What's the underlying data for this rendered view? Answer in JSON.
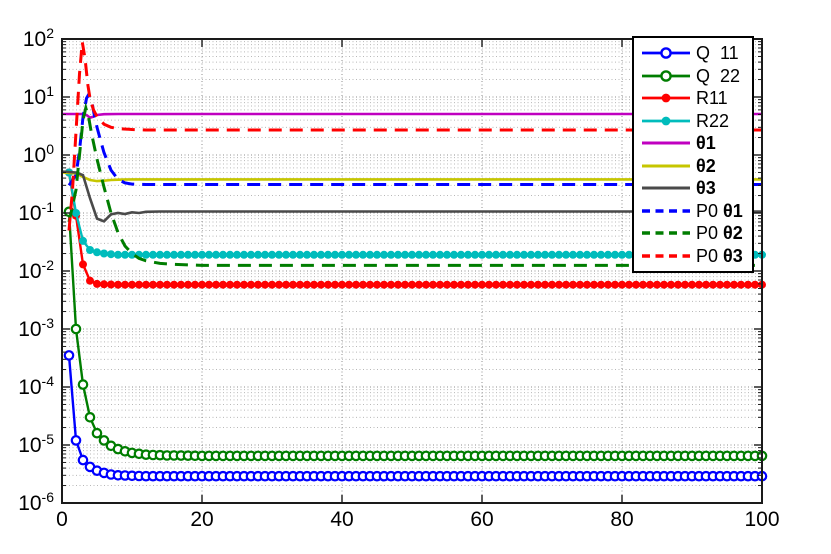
{
  "chart_data": {
    "type": "line",
    "title": "",
    "xlabel": "",
    "ylabel": "",
    "xlim": [
      0,
      100
    ],
    "ylim_log10": [
      -6,
      2
    ],
    "x_ticks": [
      0,
      20,
      40,
      60,
      80,
      100
    ],
    "y_tick_exponents": [
      2,
      1,
      0,
      -1,
      -2,
      -3,
      -4,
      -5,
      -6
    ],
    "grid": "dotted major + log-minor horizontal lines, dotted vertical at x ticks",
    "legend_position": "top-right",
    "series": [
      {
        "name": "Q11",
        "legend_pre": "Q  11",
        "legend_bold": "",
        "color": "#0000ff",
        "line": "solid",
        "marker": "open-circle",
        "width": 2.4,
        "points": [
          [
            1,
            0.00035
          ],
          [
            2,
            1.2e-05
          ],
          [
            3,
            5.5e-06
          ],
          [
            4,
            4.2e-06
          ],
          [
            5,
            3.6e-06
          ],
          [
            6,
            3.3e-06
          ],
          [
            7,
            3.1e-06
          ],
          [
            8,
            3e-06
          ],
          [
            10,
            2.95e-06
          ],
          [
            12,
            2.9e-06
          ],
          [
            100,
            2.9e-06
          ]
        ]
      },
      {
        "name": "Q22",
        "legend_pre": "Q  22",
        "legend_bold": "",
        "color": "#007d00",
        "line": "solid",
        "marker": "open-circle",
        "width": 2.4,
        "points": [
          [
            1,
            0.105
          ],
          [
            2,
            0.001
          ],
          [
            3,
            0.00011
          ],
          [
            4,
            3e-05
          ],
          [
            5,
            1.6e-05
          ],
          [
            6,
            1.2e-05
          ],
          [
            7,
            9.7e-06
          ],
          [
            8,
            8.5e-06
          ],
          [
            9,
            7.8e-06
          ],
          [
            10,
            7.3e-06
          ],
          [
            12,
            6.8e-06
          ],
          [
            15,
            6.6e-06
          ],
          [
            20,
            6.5e-06
          ],
          [
            100,
            6.5e-06
          ]
        ]
      },
      {
        "name": "R11",
        "legend_pre": "R11",
        "legend_bold": "",
        "color": "#ff0000",
        "line": "solid",
        "marker": "filled-circle",
        "width": 2.4,
        "points": [
          [
            1,
            0.5
          ],
          [
            2,
            0.09
          ],
          [
            3,
            0.013
          ],
          [
            4,
            0.0068
          ],
          [
            5,
            0.006
          ],
          [
            6,
            0.0059
          ],
          [
            8,
            0.0058
          ],
          [
            100,
            0.0058
          ]
        ]
      },
      {
        "name": "R22",
        "legend_pre": "R22",
        "legend_bold": "",
        "color": "#00bcbc",
        "line": "solid",
        "marker": "filled-circle",
        "width": 2.4,
        "points": [
          [
            1,
            0.5
          ],
          [
            2,
            0.1
          ],
          [
            3,
            0.033
          ],
          [
            4,
            0.023
          ],
          [
            5,
            0.021
          ],
          [
            6,
            0.02
          ],
          [
            8,
            0.019
          ],
          [
            100,
            0.019
          ]
        ]
      },
      {
        "name": "theta1",
        "legend_pre": "",
        "legend_bold": "θ1",
        "color": "#c000c0",
        "line": "solid",
        "marker": "none",
        "width": 2.6,
        "points": [
          [
            0,
            5.1
          ],
          [
            3,
            5.1
          ],
          [
            3.5,
            4.9
          ],
          [
            4,
            4.4
          ],
          [
            4.5,
            4.6
          ],
          [
            5,
            4.9
          ],
          [
            6,
            5.05
          ],
          [
            8,
            5.1
          ],
          [
            100,
            5.1
          ]
        ]
      },
      {
        "name": "theta2",
        "legend_pre": "",
        "legend_bold": "θ2",
        "color": "#c6c600",
        "line": "solid",
        "marker": "none",
        "width": 2.6,
        "points": [
          [
            0,
            0.5
          ],
          [
            2,
            0.48
          ],
          [
            3,
            0.42
          ],
          [
            4,
            0.37
          ],
          [
            5,
            0.355
          ],
          [
            6,
            0.36
          ],
          [
            7,
            0.37
          ],
          [
            8,
            0.375
          ],
          [
            10,
            0.38
          ],
          [
            100,
            0.38
          ]
        ]
      },
      {
        "name": "theta3",
        "legend_pre": "",
        "legend_bold": "θ3",
        "color": "#4a4a4a",
        "line": "solid",
        "marker": "none",
        "width": 2.6,
        "points": [
          [
            0,
            0.52
          ],
          [
            2,
            0.5
          ],
          [
            3,
            0.45
          ],
          [
            4,
            0.18
          ],
          [
            5,
            0.08
          ],
          [
            6,
            0.072
          ],
          [
            7,
            0.095
          ],
          [
            8,
            0.1
          ],
          [
            9,
            0.096
          ],
          [
            10,
            0.103
          ],
          [
            11,
            0.1
          ],
          [
            12,
            0.105
          ],
          [
            14,
            0.106
          ],
          [
            100,
            0.106
          ]
        ]
      },
      {
        "name": "P0-theta1",
        "legend_pre": "P0 ",
        "legend_bold": "θ1",
        "color": "#0000ff",
        "line": "dashed",
        "marker": "none",
        "width": 3,
        "points": [
          [
            1,
            0.3
          ],
          [
            2,
            0.45
          ],
          [
            2.5,
            1.2
          ],
          [
            3,
            4.5
          ],
          [
            3.5,
            9.5
          ],
          [
            3.8,
            11
          ],
          [
            4.2,
            9
          ],
          [
            4.6,
            5
          ],
          [
            5,
            3
          ],
          [
            5.5,
            1.8
          ],
          [
            6,
            1.1
          ],
          [
            7,
            0.55
          ],
          [
            8,
            0.38
          ],
          [
            9,
            0.33
          ],
          [
            10,
            0.315
          ],
          [
            12,
            0.31
          ],
          [
            100,
            0.31
          ]
        ]
      },
      {
        "name": "P0-theta2",
        "legend_pre": "P0 ",
        "legend_bold": "θ2",
        "color": "#007d00",
        "line": "dashed",
        "marker": "none",
        "width": 3,
        "points": [
          [
            1,
            0.07
          ],
          [
            2,
            0.25
          ],
          [
            2.5,
            1.0
          ],
          [
            3,
            4
          ],
          [
            3.4,
            6.5
          ],
          [
            3.8,
            4.5
          ],
          [
            4.2,
            2.4
          ],
          [
            5,
            0.85
          ],
          [
            6,
            0.28
          ],
          [
            7,
            0.1
          ],
          [
            8,
            0.046
          ],
          [
            9,
            0.027
          ],
          [
            10,
            0.02
          ],
          [
            11,
            0.0165
          ],
          [
            12,
            0.015
          ],
          [
            14,
            0.0135
          ],
          [
            16,
            0.013
          ],
          [
            20,
            0.0125
          ],
          [
            100,
            0.0125
          ]
        ]
      },
      {
        "name": "P0-theta3",
        "legend_pre": "P0 ",
        "legend_bold": "θ3",
        "color": "#ff0000",
        "line": "dashed",
        "marker": "none",
        "width": 3,
        "points": [
          [
            1,
            0.05
          ],
          [
            1.5,
            0.25
          ],
          [
            2,
            2.5
          ],
          [
            2.5,
            25
          ],
          [
            2.9,
            88
          ],
          [
            3.3,
            45
          ],
          [
            3.7,
            16
          ],
          [
            4,
            9.5
          ],
          [
            4.5,
            6
          ],
          [
            5,
            4.6
          ],
          [
            6,
            3.4
          ],
          [
            7,
            3.0
          ],
          [
            8,
            2.85
          ],
          [
            10,
            2.75
          ],
          [
            12,
            2.7
          ],
          [
            100,
            2.7
          ]
        ]
      }
    ]
  }
}
